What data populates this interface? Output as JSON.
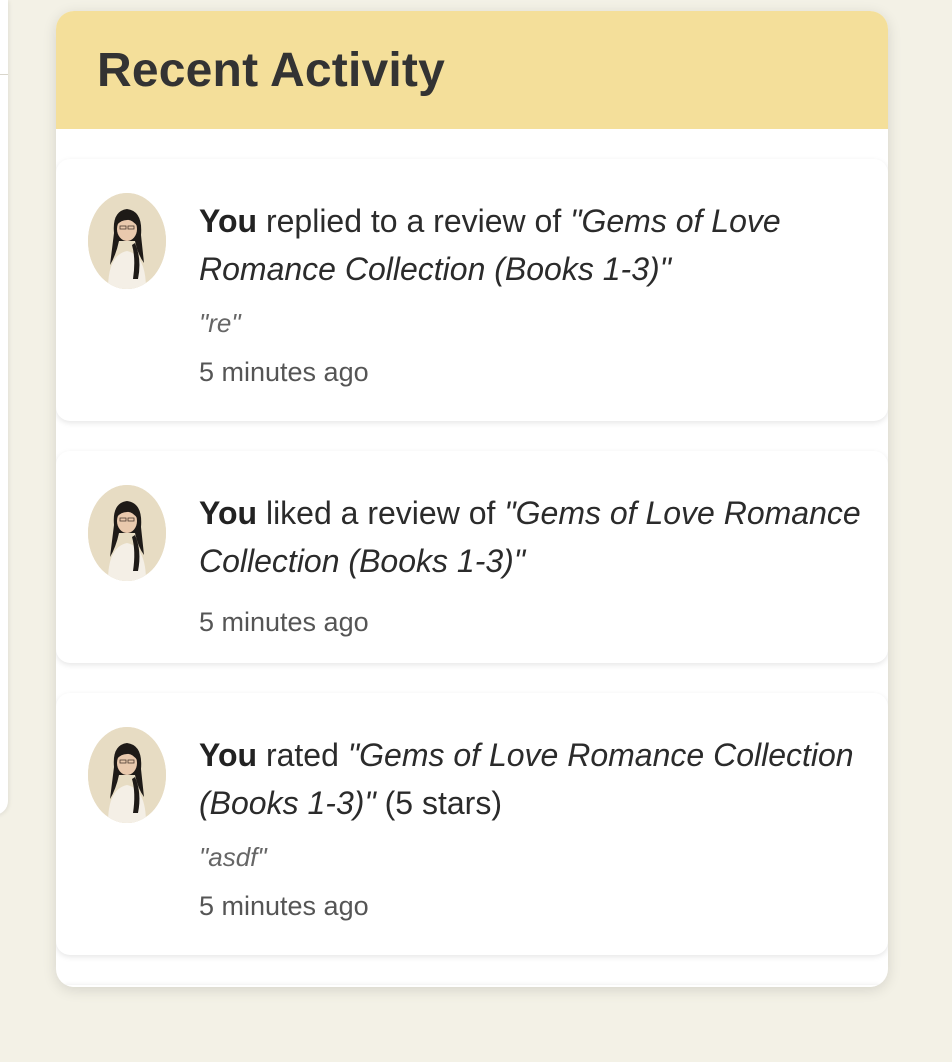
{
  "panel": {
    "title": "Recent Activity"
  },
  "activities": [
    {
      "actor": "You",
      "action": " replied to a review of ",
      "book": "\"Gems of Love Romance Collection (Books 1-3)\"",
      "suffix": "",
      "quote": "\"re\"",
      "time": "5 minutes ago",
      "avatar_icon": "user-avatar-photo"
    },
    {
      "actor": "You",
      "action": " liked a review of ",
      "book": "\"Gems of Love Romance Collection (Books 1-3)\"",
      "suffix": "",
      "quote": "",
      "time": "5 minutes ago",
      "avatar_icon": "user-avatar-photo"
    },
    {
      "actor": "You",
      "action": " rated ",
      "book": "\"Gems of Love Romance Collection (Books 1-3)\"",
      "suffix": " (5 stars)",
      "quote": "\"asdf\"",
      "time": "5 minutes ago",
      "avatar_icon": "user-avatar-photo"
    }
  ],
  "colors": {
    "header_bg": "#f4df9a",
    "page_bg": "#f3f1e6",
    "card_bg": "#ffffff",
    "text_primary": "#2b2b2b",
    "text_muted": "#555555"
  }
}
